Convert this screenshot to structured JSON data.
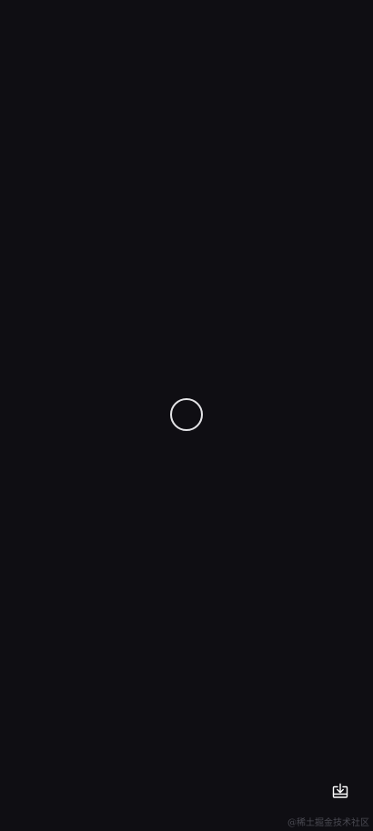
{
  "viewer": {
    "state": "loading",
    "background": "#0f0e13",
    "spinner_color": "#e4e4e7"
  },
  "toolbar": {
    "download_icon": "download-icon"
  },
  "watermark": {
    "text": "@稀土掘金技术社区"
  }
}
